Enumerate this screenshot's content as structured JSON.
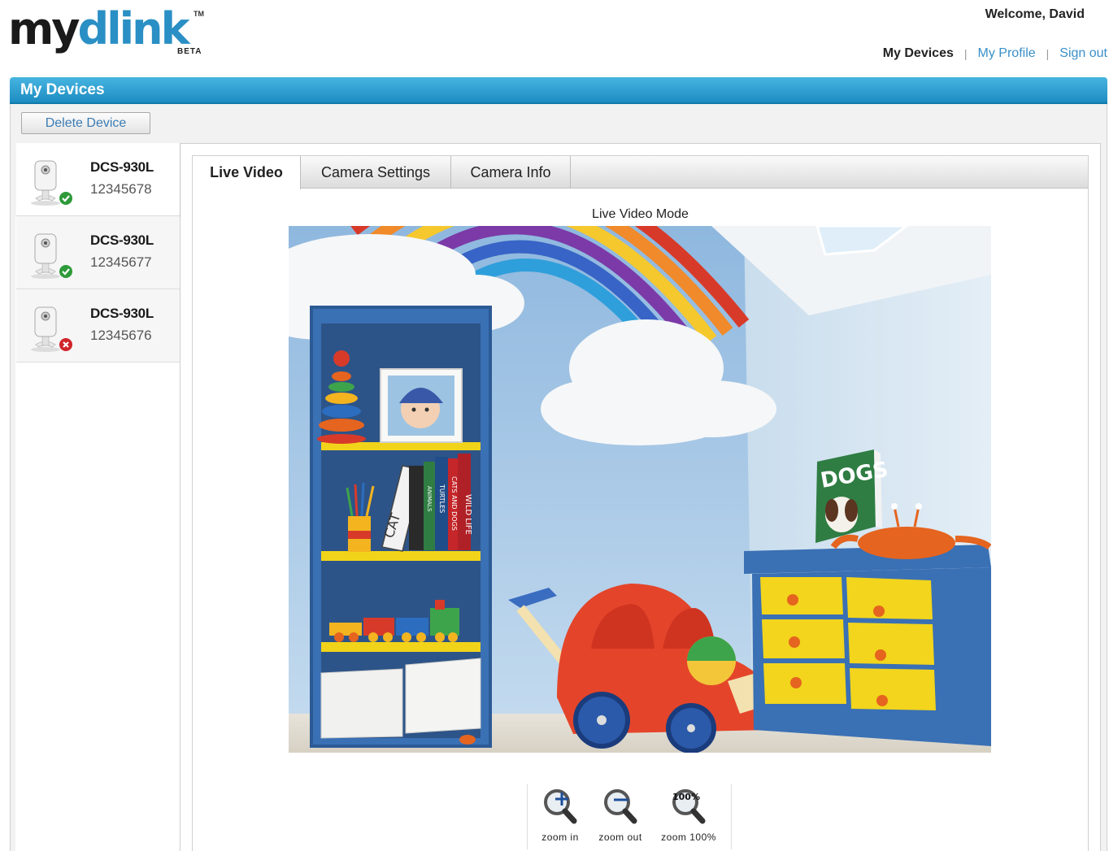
{
  "header": {
    "logo": {
      "my": "my",
      "dlink": "dlink",
      "tm": "TM",
      "beta": "BETA"
    },
    "welcome": "Welcome, David",
    "nav": {
      "current": "My Devices",
      "separator": "|",
      "profile": "My Profile",
      "signout": "Sign out"
    }
  },
  "page": {
    "title": "My Devices",
    "delete_label": "Delete Device"
  },
  "devices": [
    {
      "model": "DCS-930L",
      "serial": "12345678",
      "status": "online",
      "selected": true
    },
    {
      "model": "DCS-930L",
      "serial": "12345677",
      "status": "online",
      "selected": false
    },
    {
      "model": "DCS-930L",
      "serial": "12345676",
      "status": "offline",
      "selected": false
    }
  ],
  "tabs": [
    {
      "label": "Live Video",
      "active": true
    },
    {
      "label": "Camera Settings",
      "active": false
    },
    {
      "label": "Camera Info",
      "active": false
    }
  ],
  "video": {
    "mode_label": "Live Video Mode",
    "scene_text": {
      "book": "DOGS",
      "spine1": "WILD LIFE",
      "spine2": "CATS AND DOGS",
      "spine3": "TURTLES",
      "spine4": "ANIMALS",
      "spine5": "CAT"
    }
  },
  "zoom": {
    "zoom_in": "zoom in",
    "zoom_out": "zoom out",
    "zoom_100": "zoom 100%",
    "zoom_100_glyph": "100%"
  },
  "colors": {
    "accent": "#1d8cc2",
    "link": "#3a8fc8",
    "online": "#2e9a3a",
    "offline": "#d0252a"
  },
  "icons": [
    "camera-icon",
    "online-check-icon",
    "offline-x-icon",
    "zoom-in-icon",
    "zoom-out-icon",
    "zoom-100-icon"
  ]
}
